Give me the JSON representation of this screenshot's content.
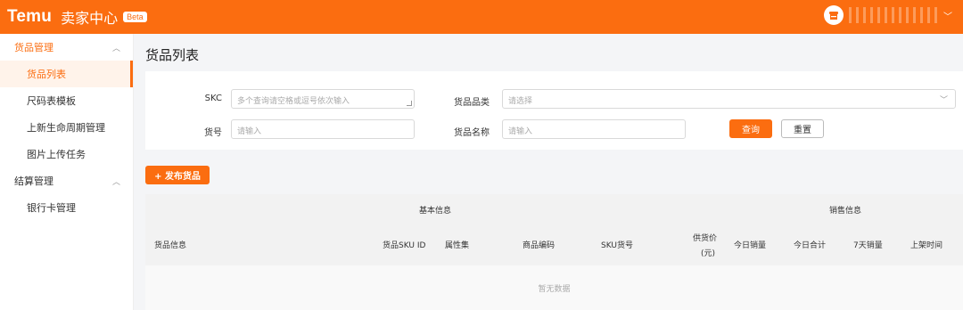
{
  "header": {
    "brand": "Temu",
    "subtitle": "卖家中心",
    "badge": "Beta",
    "store_icon": "store-icon",
    "account_caret": "﹀"
  },
  "sidebar": {
    "groups": [
      {
        "label": "货品管理",
        "items": [
          "货品列表",
          "尺码表模板",
          "上新生命周期管理",
          "图片上传任务"
        ]
      },
      {
        "label": "结算管理",
        "items": [
          "银行卡管理"
        ]
      }
    ]
  },
  "page": {
    "title": "货品列表"
  },
  "filters": {
    "skc": {
      "label": "SKC",
      "placeholder": "多个查询请空格或逗号依次输入"
    },
    "category": {
      "label": "货品品类",
      "placeholder": "请选择"
    },
    "item_no": {
      "label": "货号",
      "placeholder": "请输入"
    },
    "name": {
      "label": "货品名称",
      "placeholder": "请输入"
    },
    "search_label": "查询",
    "reset_label": "重置"
  },
  "actions": {
    "publish_label": "+ 发布货品"
  },
  "table": {
    "groups": {
      "basic": "基本信息",
      "sales": "销售信息"
    },
    "columns": [
      "货品信息",
      "货品SKU ID",
      "属性集",
      "商品编码",
      "SKU货号",
      "供货价",
      "(元)",
      "今日销量",
      "今日合计",
      "7天销量",
      "上架时间"
    ],
    "empty_text": "暂无数据"
  },
  "colors": {
    "accent": "#fb6d10",
    "active_bg": "#fff3ea"
  }
}
